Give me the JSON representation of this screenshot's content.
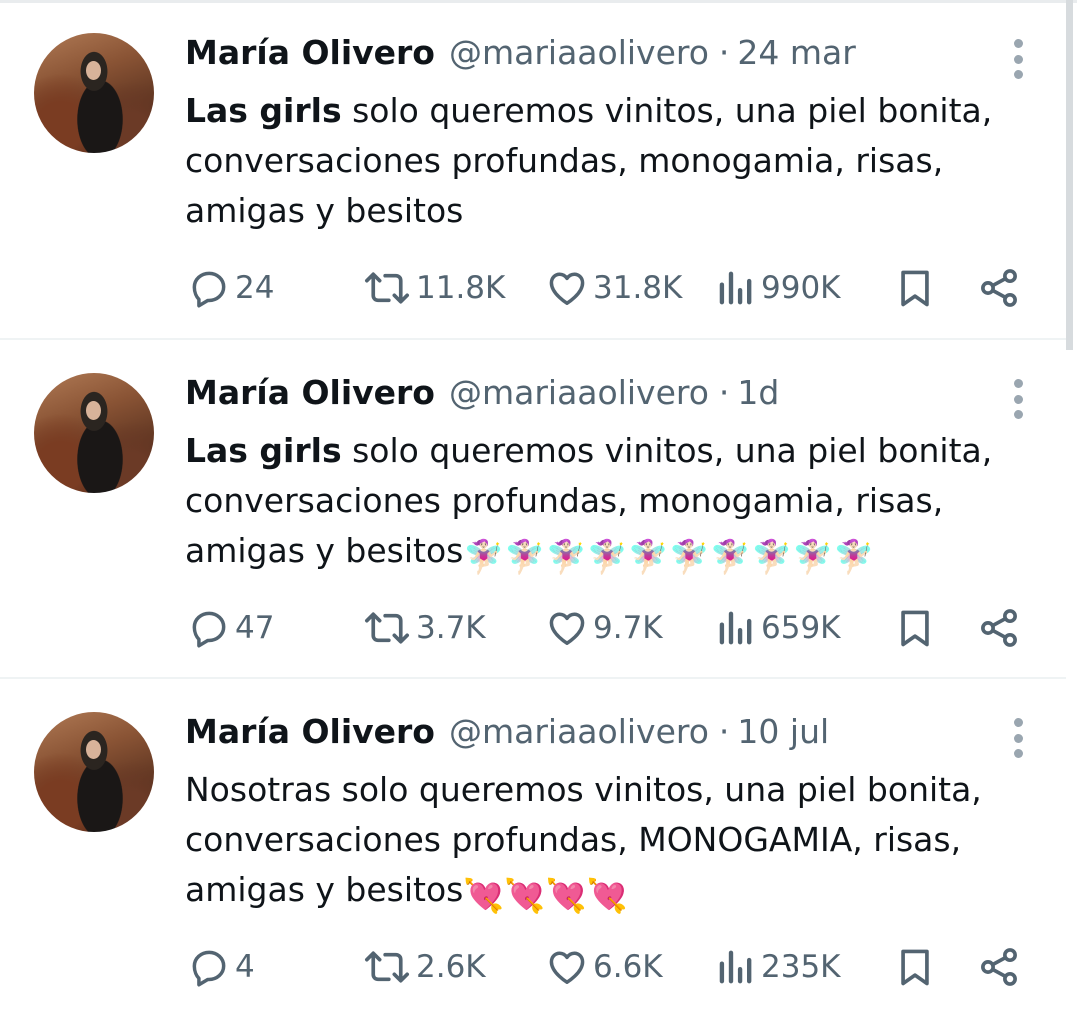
{
  "colors": {
    "text": "#0f1419",
    "muted": "#536471",
    "divider": "#eff3f4"
  },
  "tweets": [
    {
      "name": "María Olivero",
      "handle": "@mariaaolivero",
      "separator": "·",
      "date": "24 mar",
      "text_bold": "Las girls",
      "text": " solo queremos vinitos, una piel bonita, conversaciones profundas, monogamia, risas, amigas y besitos",
      "emoji": "",
      "replies": "24",
      "reposts": "11.8K",
      "likes": "31.8K",
      "views": "990K"
    },
    {
      "name": "María Olivero",
      "handle": "@mariaaolivero",
      "separator": "·",
      "date": "1d",
      "text_bold": "Las girls",
      "text": " solo queremos vinitos, una piel bonita, conversaciones profundas, monogamia, risas, amigas y besitos",
      "emoji": "🧚🏻‍♀️🧚🏻‍♀️🧚🏻‍♀️🧚🏻‍♀️🧚🏻‍♀️🧚🏻‍♀️🧚🏻‍♀️🧚🏻‍♀️🧚🏻‍♀️🧚🏻‍♀️",
      "replies": "47",
      "reposts": "3.7K",
      "likes": "9.7K",
      "views": "659K"
    },
    {
      "name": "María Olivero",
      "handle": "@mariaaolivero",
      "separator": "·",
      "date": "10 jul",
      "text_bold": "",
      "text": "Nosotras solo queremos vinitos, una piel bonita, conversaciones profundas, MONOGAMIA, risas, amigas y besitos",
      "emoji": "💘💘💘💘",
      "replies": "4",
      "reposts": "2.6K",
      "likes": "6.6K",
      "views": "235K"
    }
  ],
  "icons": {
    "reply": "reply-icon",
    "repost": "repost-icon",
    "like": "heart-icon",
    "views": "views-icon",
    "bookmark": "bookmark-icon",
    "share": "share-icon",
    "more": "more-icon"
  }
}
